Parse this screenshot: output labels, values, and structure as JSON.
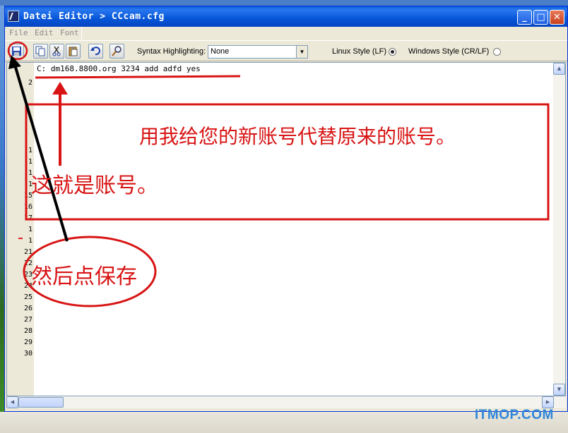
{
  "window": {
    "title": "Datei Editor > CCcam.cfg",
    "controls": {
      "minimize": "_",
      "maximize": "□",
      "close": "✕"
    }
  },
  "menu": [
    "File",
    "Edit",
    "Font"
  ],
  "toolbar": {
    "icons": [
      "save-icon",
      "copy-icon",
      "cut-icon",
      "paste-icon",
      "undo-icon",
      "find-icon"
    ],
    "syntax_label": "Syntax Highlighting:",
    "syntax_value": "None",
    "linux_label": "Linux Style (LF)",
    "windows_label": "Windows Style (CR/LF)",
    "line_ending_selected": "Linux Style (LF)"
  },
  "editor": {
    "content": "C: dm168.8800.org 3234 add adfd yes",
    "line_numbers": [
      "2",
      "1",
      "1",
      "1",
      "1",
      "15",
      "16",
      "17",
      "1",
      "1",
      "21",
      "22",
      "23",
      "24",
      "25",
      "26",
      "27",
      "28",
      "29",
      "30"
    ]
  },
  "annotations": {
    "instruction": "用我给您的新账号代替原来的账号。",
    "account_label": "这就是账号。",
    "save_label": "然后点保存"
  },
  "watermark": "ITMOP.COM",
  "colors": {
    "annotation": "#d81414",
    "title_bar": "#0756d8",
    "watermark": "#2f86d8"
  }
}
